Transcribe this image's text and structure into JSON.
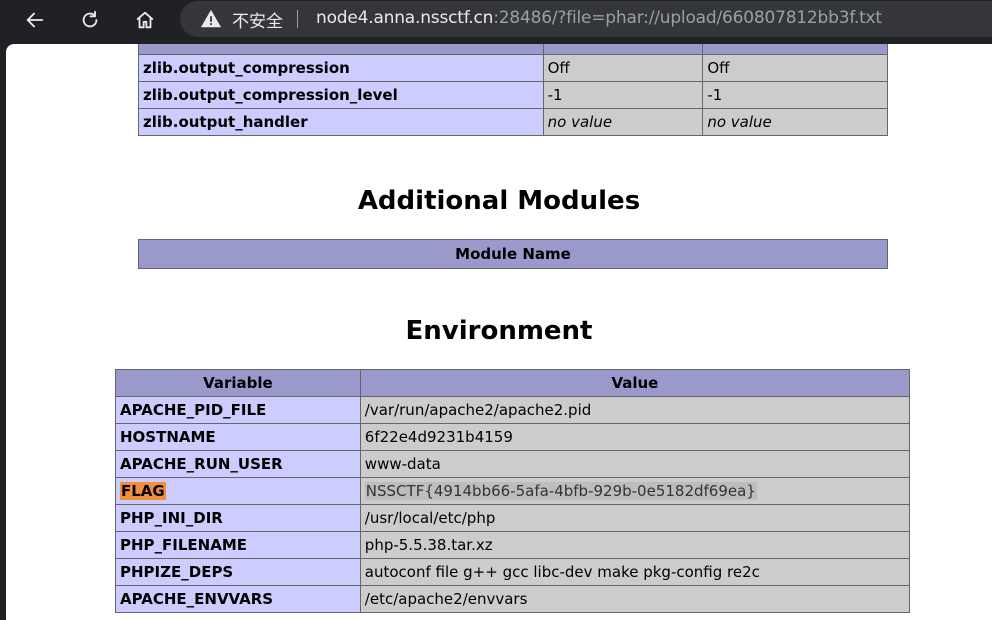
{
  "browser": {
    "security_label": "不安全",
    "url_host": "node4.anna.nssctf.cn",
    "url_rest": ":28486/?file=phar://upload/660807812bb3f.txt",
    "icons": [
      "back-arrow-icon",
      "reload-icon",
      "home-icon",
      "warning-icon"
    ]
  },
  "zlib_table": {
    "rows": [
      {
        "directive": "zlib.output_compression",
        "local": "Off",
        "master": "Off"
      },
      {
        "directive": "zlib.output_compression_level",
        "local": "-1",
        "master": "-1"
      },
      {
        "directive": "zlib.output_handler",
        "local": "no value",
        "master": "no value"
      }
    ]
  },
  "additional_modules": {
    "title": "Additional Modules",
    "header": "Module Name"
  },
  "environment": {
    "title": "Environment",
    "headers": {
      "variable": "Variable",
      "value": "Value"
    },
    "rows": [
      {
        "variable": "APACHE_PID_FILE",
        "value": "/var/run/apache2/apache2.pid"
      },
      {
        "variable": "HOSTNAME",
        "value": "6f22e4d9231b4159"
      },
      {
        "variable": "APACHE_RUN_USER",
        "value": "www-data"
      },
      {
        "variable": "FLAG",
        "value": "NSSCTF{4914bb66-5afa-4bfb-929b-0e5182df69ea}"
      },
      {
        "variable": "PHP_INI_DIR",
        "value": "/usr/local/etc/php"
      },
      {
        "variable": "PHP_FILENAME",
        "value": "php-5.5.38.tar.xz"
      },
      {
        "variable": "PHPIZE_DEPS",
        "value": "autoconf file g++ gcc libc-dev make pkg-config re2c"
      },
      {
        "variable": "APACHE_ENVVARS",
        "value": "/etc/apache2/envvars"
      }
    ]
  },
  "colors": {
    "header_bg": "#9999cc",
    "key_bg": "#ccccff",
    "value_bg": "#cccccc",
    "flag_highlight": "#f48d3a"
  }
}
